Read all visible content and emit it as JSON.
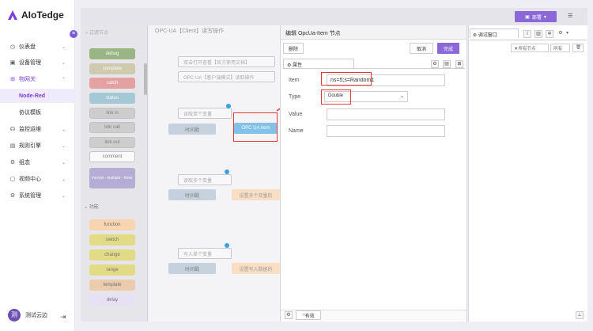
{
  "app": {
    "title": "AIoTedge"
  },
  "sidebar": {
    "items": [
      {
        "label": "仪表盘",
        "icon": "dashboard-icon",
        "glyph": "◷",
        "chevron": "⌄"
      },
      {
        "label": "设备管理",
        "icon": "device-icon",
        "glyph": "▣",
        "chevron": "⌄"
      },
      {
        "label": "物网关",
        "icon": "gateway-icon",
        "glyph": "⊞",
        "chevron": "⌃"
      },
      {
        "label": "Node-Red"
      },
      {
        "label": "协议模板"
      },
      {
        "label": "监控运维",
        "icon": "monitor-icon",
        "glyph": "☊",
        "chevron": "⌄"
      },
      {
        "label": "规则引擎",
        "icon": "rule-icon",
        "glyph": "▤",
        "chevron": "⌄"
      },
      {
        "label": "组态",
        "icon": "config-icon",
        "glyph": "⚙",
        "chevron": "⌄"
      },
      {
        "label": "视频中心",
        "icon": "video-icon",
        "glyph": "▢",
        "chevron": "⌄"
      },
      {
        "label": "系统管理",
        "icon": "system-icon",
        "glyph": "⚙",
        "chevron": "⌄"
      }
    ],
    "collapse_glyph": "≡",
    "user": {
      "name": "测试云边",
      "avatar": "测"
    }
  },
  "topbar": {
    "deploy_label": "部署"
  },
  "palette": {
    "search": "过滤节点",
    "nodes": [
      {
        "label": "debug",
        "color": "#87a96b"
      },
      {
        "label": "complete",
        "color": "#c7c4a0"
      },
      {
        "label": "catch",
        "color": "#e49191"
      },
      {
        "label": "status",
        "color": "#94c1d0"
      },
      {
        "label": "link in",
        "color": "#c7c7c7"
      },
      {
        "label": "link call",
        "color": "#c7c7c7"
      },
      {
        "label": "link out",
        "color": "#c7c7c7"
      },
      {
        "label": "comment",
        "color": "#ffffff"
      },
      {
        "label": "inerval - multiple - timer",
        "color": "#a9a0cf"
      }
    ],
    "section": "功能",
    "func_nodes": [
      {
        "label": "function",
        "color": "#fdd0a2"
      },
      {
        "label": "switch",
        "color": "#e2d96e"
      },
      {
        "label": "change",
        "color": "#e2d96e"
      },
      {
        "label": "range",
        "color": "#e2d96e"
      },
      {
        "label": "template",
        "color": "#ecc59e"
      },
      {
        "label": "delay",
        "color": "#e6e0f8"
      }
    ]
  },
  "workspace": {
    "tab": "OPC-UA【Client】读写操作",
    "comments": [
      "双击打开查看【官方使用文档】",
      "OPC-UA【客户端模式】读取操作"
    ],
    "labels": [
      "读取单个变量",
      "读取多个变量",
      "写入单个变量"
    ],
    "timer": "时间戳",
    "opc_node": "OPC UA Item",
    "multi_read": "设置多个变量的",
    "write_node": "设置写入数据的"
  },
  "editor": {
    "title": "编辑 OpcUa-Item 节点",
    "delete": "删除",
    "cancel": "取消",
    "done": "完成",
    "props_tab": "属性",
    "fields": {
      "item": {
        "label": "Item",
        "value": "ns=5;s=Random1"
      },
      "type": {
        "label": "Type",
        "value": "Double"
      },
      "value": {
        "label": "Value",
        "value": ""
      },
      "name": {
        "label": "Name",
        "value": ""
      }
    },
    "footer_status": "有效"
  },
  "debug": {
    "tab": "调试窗口",
    "filter_nodes": "所有节点",
    "filter_all": "所有"
  },
  "colors": {
    "accent": "#7b3fd9",
    "primary_button": "#8a68d8",
    "highlight": "#e23b3b"
  }
}
